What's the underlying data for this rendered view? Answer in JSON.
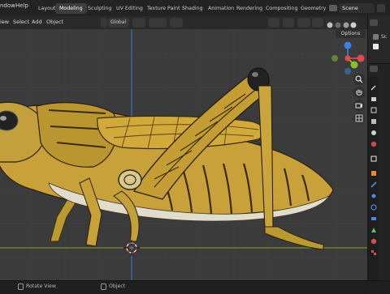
{
  "menu": {
    "window": "ndow",
    "help": "Help"
  },
  "workspaces": [
    {
      "label": "Layout"
    },
    {
      "label": "Modeling",
      "active": true
    },
    {
      "label": "Sculpting"
    },
    {
      "label": "UV Editing"
    },
    {
      "label": "Texture Paint"
    },
    {
      "label": "Shading"
    },
    {
      "label": "Animation"
    },
    {
      "label": "Rendering"
    },
    {
      "label": "Compositing"
    },
    {
      "label": "Geometry N"
    }
  ],
  "scene": {
    "name": "Scene"
  },
  "viewport_header": {
    "view": "iew",
    "select": "Select",
    "add": "Add",
    "object": "Object",
    "orientation": "Global",
    "options": "Options"
  },
  "gizmo": {
    "x": "X",
    "y": "Y",
    "z": "Z"
  },
  "outliner": {
    "label": "Sc"
  },
  "status": {
    "rotate_view": "Rotate View",
    "object": "Object"
  },
  "colors": {
    "accent": "#4772b3",
    "axis_x": "#e54a4a",
    "axis_y": "#8bbf2c",
    "axis_z": "#3d7fe6",
    "viewport_bg": "#3b3b3b"
  },
  "icons": [
    "zoom-icon",
    "hand-icon",
    "camera-icon",
    "grid-icon",
    "tool-icon",
    "render-icon",
    "output-icon",
    "view-layer-icon",
    "scene-icon",
    "world-icon",
    "collection-icon",
    "object-icon",
    "modifier-icon",
    "particles-icon",
    "physics-icon",
    "constraints-icon",
    "data-icon",
    "material-icon",
    "texture-icon"
  ]
}
